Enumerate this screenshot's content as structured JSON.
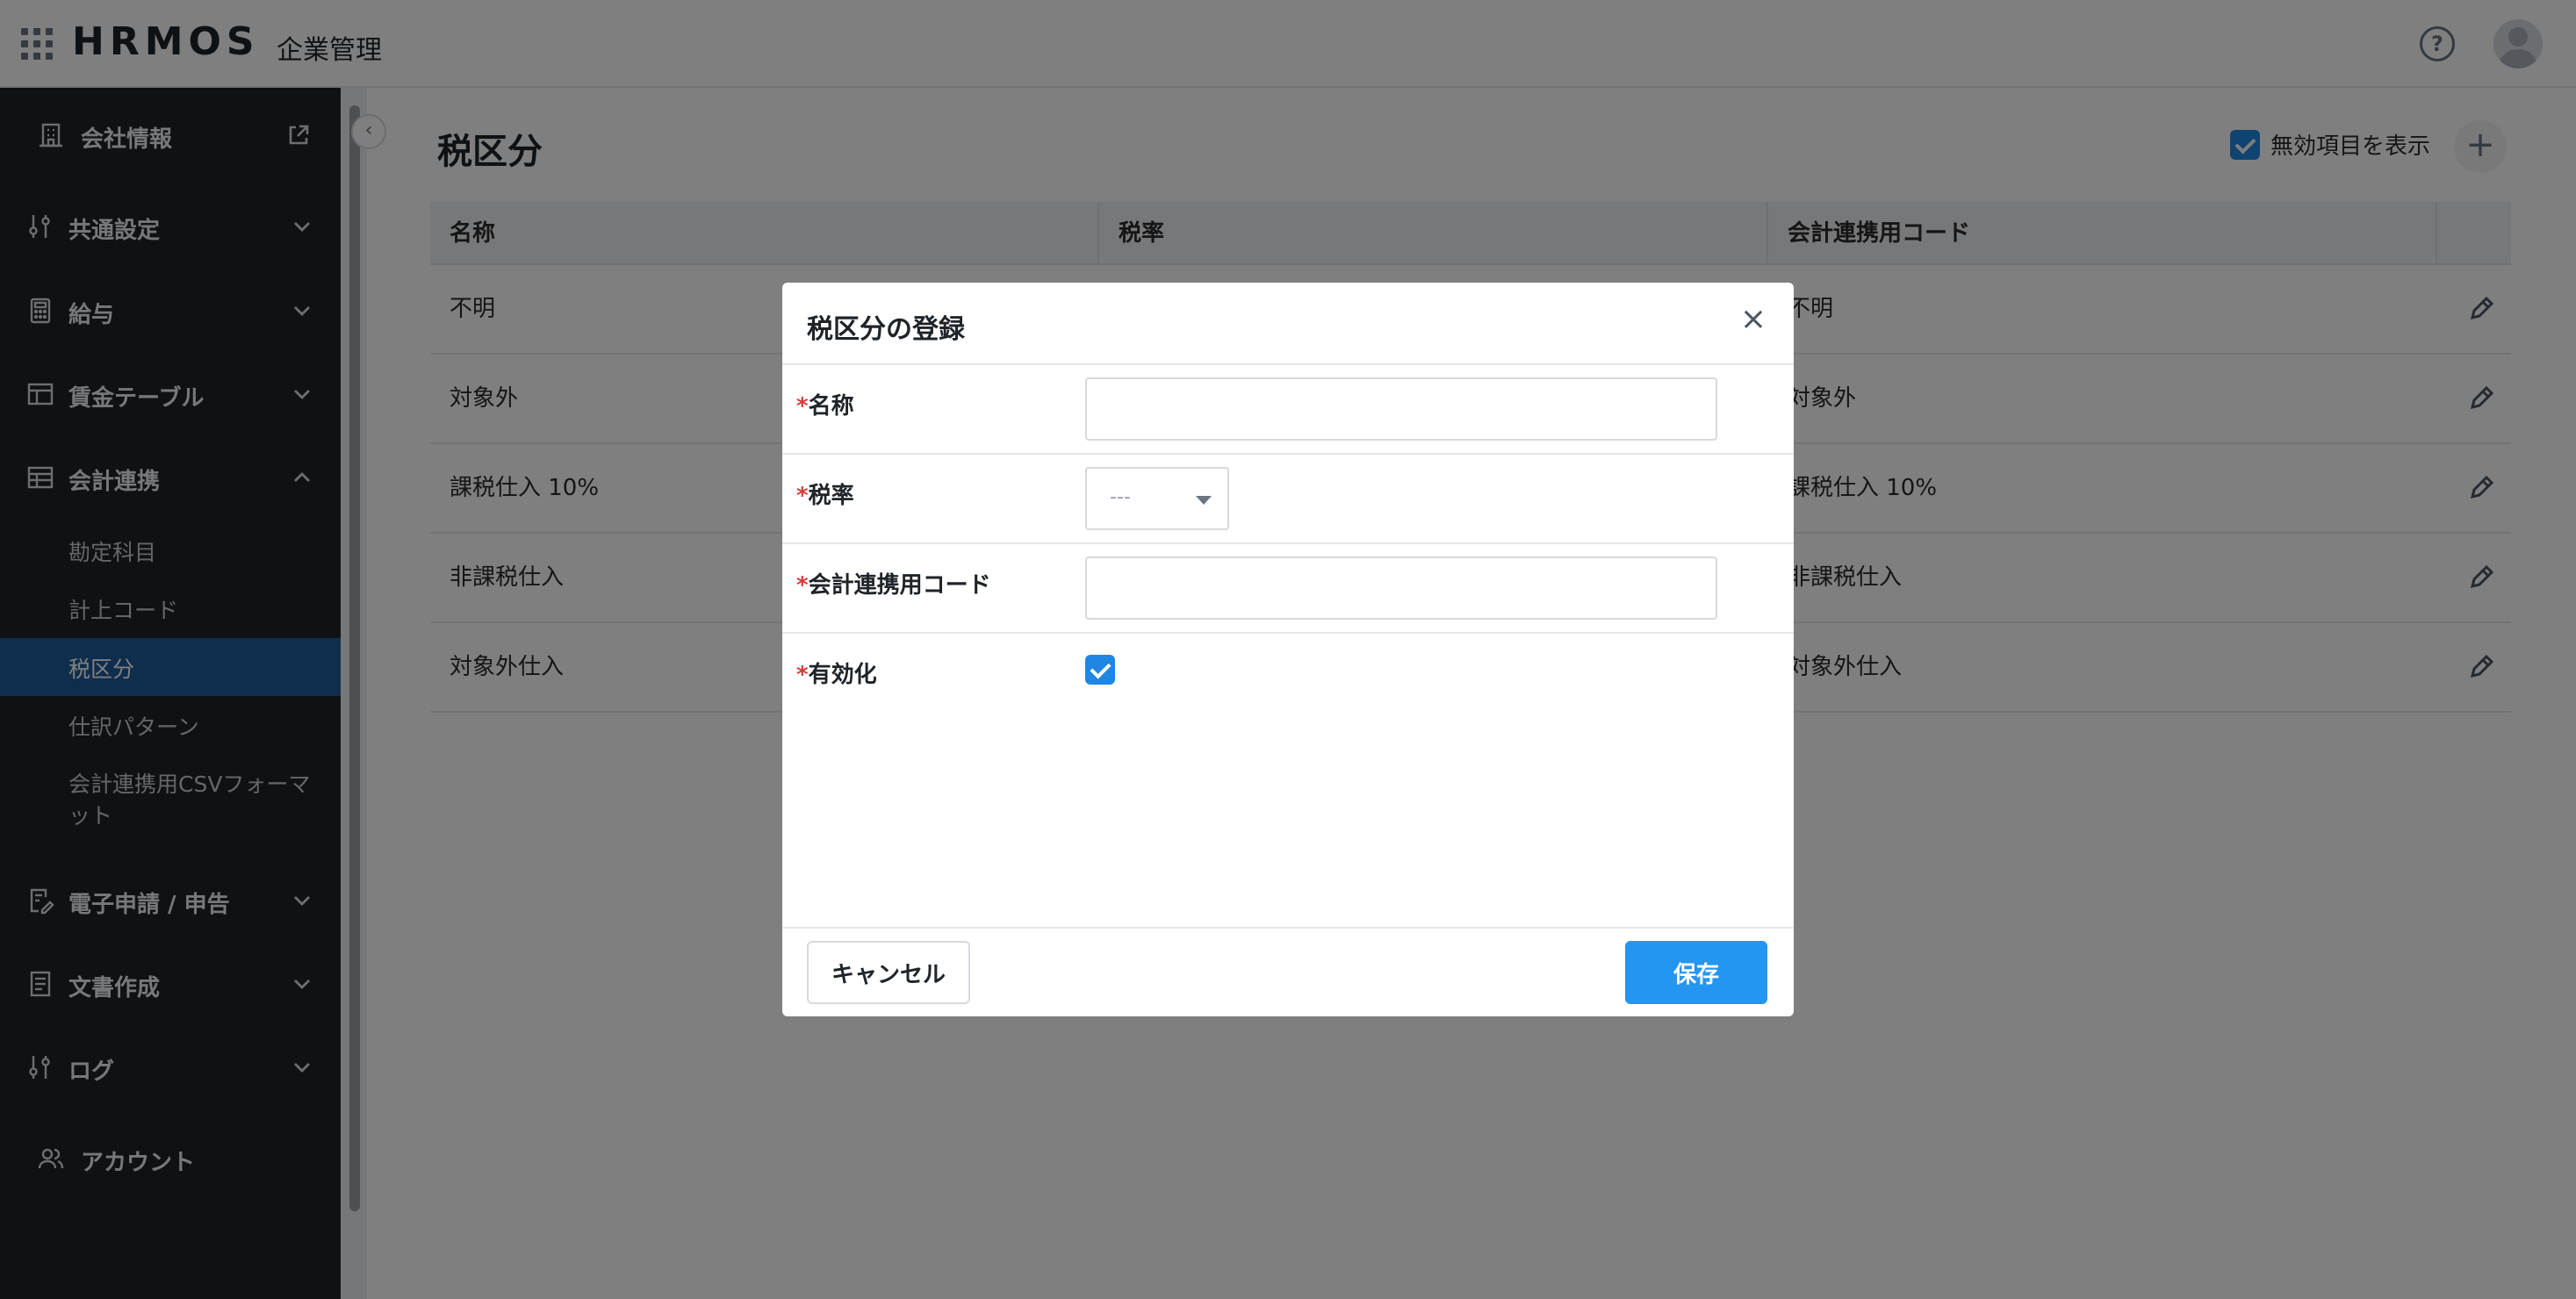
{
  "header": {
    "logo": "HRMOS",
    "app_name": "企業管理",
    "help_icon": "help-circle-icon",
    "avatar_icon": "user-avatar-icon"
  },
  "sidebar": {
    "company_info": {
      "label": "会社情報",
      "icon": "building-icon",
      "action_icon": "external-link-icon"
    },
    "sections": [
      {
        "label": "共通設定",
        "icon": "sliders-icon",
        "expanded": false
      },
      {
        "label": "給与",
        "icon": "calculator-icon",
        "expanded": false
      },
      {
        "label": "賃金テーブル",
        "icon": "table-icon",
        "expanded": false
      },
      {
        "label": "会計連携",
        "icon": "table-icon",
        "expanded": true
      },
      {
        "label": "電子申請 / 申告",
        "icon": "document-edit-icon",
        "expanded": false
      },
      {
        "label": "文書作成",
        "icon": "document-icon",
        "expanded": false
      },
      {
        "label": "ログ",
        "icon": "sliders-icon",
        "expanded": false
      }
    ],
    "accounting_items": [
      {
        "label": "勘定科目",
        "active": false
      },
      {
        "label": "計上コード",
        "active": false
      },
      {
        "label": "税区分",
        "active": true
      },
      {
        "label": "仕訳パターン",
        "active": false
      },
      {
        "label": "会計連携用CSVフォーマット",
        "active": false
      }
    ],
    "account": {
      "label": "アカウント",
      "icon": "users-icon"
    }
  },
  "main": {
    "title": "税区分",
    "show_disabled_label": "無効項目を表示",
    "show_disabled_checked": true,
    "add_icon": "plus-icon",
    "table": {
      "columns": [
        "名称",
        "税率",
        "会計連携用コード"
      ],
      "rows": [
        {
          "name": "不明",
          "rate": "",
          "code": "不明"
        },
        {
          "name": "対象外",
          "rate": "",
          "code": "対象外"
        },
        {
          "name": "課税仕入 10%",
          "rate": "",
          "code": "課税仕入 10%"
        },
        {
          "name": "非課税仕入",
          "rate": "",
          "code": "非課税仕入"
        },
        {
          "name": "対象外仕入",
          "rate": "",
          "code": "対象外仕入"
        }
      ],
      "edit_icon": "pencil-icon"
    }
  },
  "modal": {
    "title": "税区分の登録",
    "close_icon": "close-icon",
    "required_mark": "*",
    "fields": {
      "name": {
        "label": "名称",
        "value": "",
        "placeholder": ""
      },
      "rate": {
        "label": "税率",
        "value": "---"
      },
      "code": {
        "label": "会計連携用コード",
        "value": "",
        "placeholder": ""
      },
      "enabled": {
        "label": "有効化",
        "checked": true
      }
    },
    "cancel_label": "キャンセル",
    "save_label": "保存"
  },
  "colors": {
    "sidebar_bg": "#1f2429",
    "active_nav": "#1e5a9b",
    "primary": "#2596f0",
    "checkbox": "#1f86e4",
    "required": "#d63b3b"
  }
}
